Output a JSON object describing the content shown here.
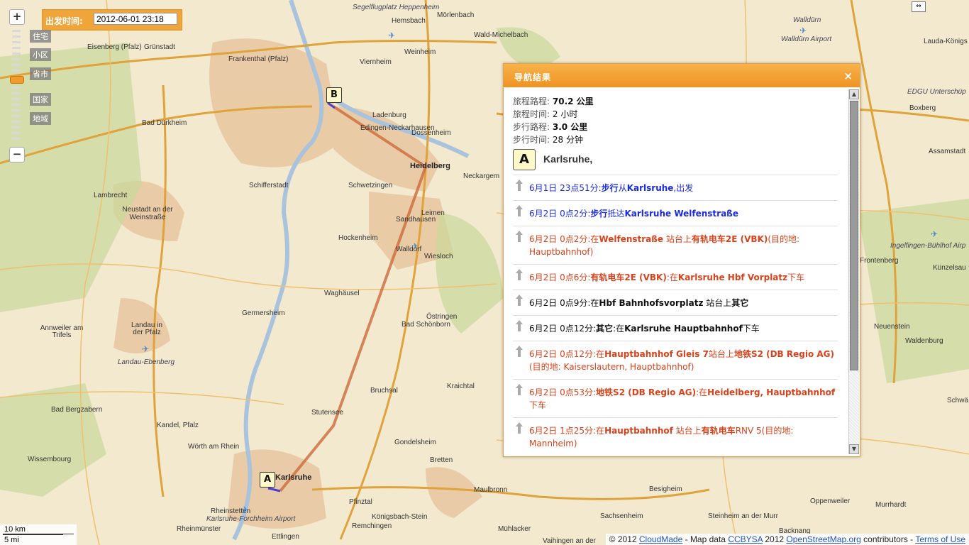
{
  "departure": {
    "label": "出发时间:",
    "value": "2012-06-01 23:18"
  },
  "zoom": {
    "zoom_in": "+",
    "zoom_out": "−",
    "levels": [
      "住宅",
      "小区",
      "省市",
      "国家",
      "地域"
    ]
  },
  "map": {
    "toggle_icon": "⇔",
    "markers": {
      "start": "A",
      "end": "B"
    },
    "places": [
      "Segelflugplatz Heppenheim",
      "Mörlenbach",
      "Hemsbach",
      "Wald-Michelbach",
      "Weinheim",
      "Viernheim",
      "Eisenberg (Pfalz)",
      "Grünstadt",
      "Frankenthal (Pfalz)",
      "Walldürn Airport",
      "Walldürn",
      "Lauda-Königs",
      "Bad Dürkheim",
      "Ladenburg",
      "Edingen-Neckarhausen",
      "Dossenheim",
      "Heidelberg",
      "Neckargem",
      "Schifferstadt",
      "Schwetzingen",
      "Lambrecht",
      "Neustadt an der Weinstraße",
      "Leimen",
      "Sandhausen",
      "Hockenheim",
      "Walldorf",
      "Wiesloch",
      "Waghäusel",
      "Germersheim",
      "Östringen",
      "Bad Schönborn",
      "Annweiler am Trifels",
      "Landau in der Pfalz",
      "Landau-Ebenberg",
      "Kraichtal",
      "Bruchsal",
      "Bad Bergzabern",
      "Stutensee",
      "Kandel, Pfalz",
      "Wörth am Rhein",
      "Gondelsheim",
      "Bretten",
      "Wissembourg",
      "Karlsruhe",
      "Rheinstetten",
      "Karlsruhe-Forchheim Airport",
      "Ettlingen",
      "Rheinmünster",
      "Pfinztal",
      "Maulbronn",
      "Königsbach-Stein",
      "Remchingen",
      "Mühlacker",
      "Vaihingen an der",
      "Besigheim",
      "Sachsenheim",
      "Steinheim an der Murr",
      "Backnang",
      "Oppenweiler",
      "Murrhardt",
      "EDGU Unterschüp",
      "Boxberg",
      "Assamstadt",
      "Ingelfingen-Bühlhof Airp",
      "Frontenberg",
      "Künzelsau",
      "Neuenstein",
      "Waldenburg",
      "Schwä"
    ]
  },
  "panel": {
    "title": "导航结果",
    "close": "×",
    "summary": [
      {
        "key": "旅程路程:",
        "value": "70.2 公里",
        "bold": true
      },
      {
        "key": "旅程时间:",
        "value": "2 小时",
        "bold": false
      },
      {
        "key": "步行路程:",
        "value": "3.0 公里",
        "bold": true
      },
      {
        "key": "步行时间:",
        "value": "28 分钟",
        "bold": false
      }
    ],
    "origin_marker": "A",
    "origin": "Karlsruhe,",
    "steps": [
      {
        "color": "blue",
        "time": "6月1日 23点51分:",
        "rest": [
          [
            "b",
            "步行"
          ],
          [
            "t",
            "从"
          ],
          [
            "b",
            "Karlsruhe"
          ],
          [
            "t",
            ",出发"
          ]
        ]
      },
      {
        "color": "blue",
        "time": "6月2日 0点2分:",
        "rest": [
          [
            "b",
            "步行"
          ],
          [
            "t",
            "抵达"
          ],
          [
            "b",
            "Karlsruhe Welfenstraße"
          ]
        ]
      },
      {
        "color": "red",
        "time": "6月2日 0点2分:",
        "rest": [
          [
            "t",
            "在"
          ],
          [
            "b",
            "Welfenstraße"
          ],
          [
            "t",
            " 站台上"
          ],
          [
            "b",
            "有轨电车2E (VBK)"
          ],
          [
            "t",
            "(目的地: Hauptbahnhof)"
          ]
        ]
      },
      {
        "color": "red",
        "time": "6月2日 0点6分:",
        "rest": [
          [
            "b",
            "有轨电车2E (VBK)"
          ],
          [
            "t",
            ":在"
          ],
          [
            "b",
            "Karlsruhe Hbf Vorplatz"
          ],
          [
            "t",
            "下车"
          ]
        ]
      },
      {
        "color": "black",
        "time": "6月2日 0点9分:",
        "rest": [
          [
            "t",
            "在"
          ],
          [
            "b",
            "Hbf Bahnhofsvorplatz"
          ],
          [
            "t",
            " 站台上"
          ],
          [
            "b",
            "其它"
          ]
        ]
      },
      {
        "color": "black",
        "time": "6月2日 0点12分:",
        "rest": [
          [
            "b",
            "其它"
          ],
          [
            "t",
            ":在"
          ],
          [
            "b",
            "Karlsruhe Hauptbahnhof"
          ],
          [
            "t",
            "下车"
          ]
        ]
      },
      {
        "color": "red",
        "time": "6月2日 0点12分:",
        "rest": [
          [
            "t",
            "在"
          ],
          [
            "b",
            "Hauptbahnhof Gleis 7"
          ],
          [
            "t",
            "站台上"
          ],
          [
            "b",
            "地铁S2 (DB Regio AG)"
          ],
          [
            "t",
            "(目的地: Kaiserslautern, Hauptbahnhof)"
          ]
        ]
      },
      {
        "color": "red",
        "time": "6月2日 0点53分:",
        "rest": [
          [
            "b",
            "地铁S2 (DB Regio AG)"
          ],
          [
            "t",
            ":在"
          ],
          [
            "b",
            "Heidelberg, Hauptbahnhof"
          ],
          [
            "t",
            "下车"
          ]
        ]
      },
      {
        "color": "red",
        "time": "6月2日 1点25分:",
        "rest": [
          [
            "t",
            "在"
          ],
          [
            "b",
            "Hauptbahnhof"
          ],
          [
            "t",
            " 站台上"
          ],
          [
            "b",
            "有轨电车"
          ],
          [
            "t",
            "RNV 5(目的地: Mannheim)"
          ]
        ]
      }
    ]
  },
  "scale": {
    "km": "10 km",
    "mi": "5 mi"
  },
  "attribution": {
    "prefix": "© 2012",
    "cloudmade": "CloudMade",
    "mid": "- Map data",
    "license": "CCBYSA",
    "year": "2012",
    "osm": "OpenStreetMap.org",
    "contributors": "contributors -",
    "terms": "Terms of Use"
  }
}
